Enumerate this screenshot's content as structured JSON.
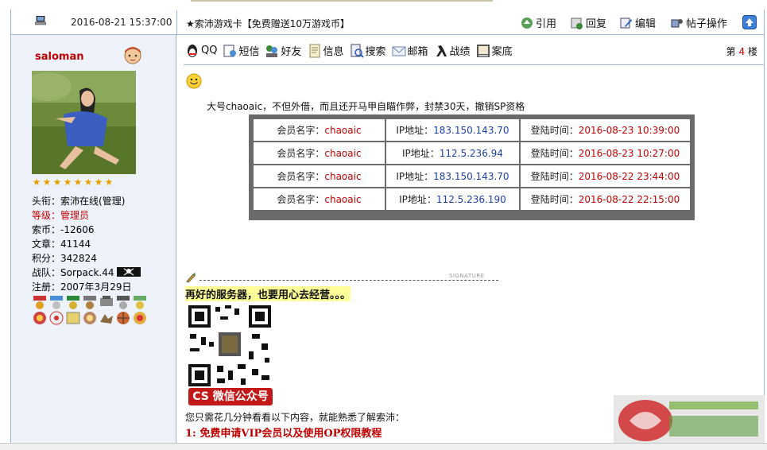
{
  "post": {
    "date": "2016-08-21 15:37:00",
    "title": "★索沛游戏卡【免费赠送10万游戏币】",
    "buttons": [
      {
        "label": "引用",
        "icon": "quote-icon"
      },
      {
        "label": "回复",
        "icon": "reply-icon"
      },
      {
        "label": "编辑",
        "icon": "edit-icon"
      },
      {
        "label": "帖子操作",
        "icon": "post-actions-icon"
      }
    ]
  },
  "user": {
    "name": "saloman",
    "stars": 8,
    "title_label": "头衔：",
    "title_value": "索沛在线(管理)",
    "level_label": "等级：",
    "level_value": "管理员",
    "coins_label": "索币：",
    "coins_value": "-12606",
    "posts_label": "文章：",
    "posts_value": "41144",
    "points_label": "积分：",
    "points_value": "342824",
    "team_label": "战队：",
    "team_value": "Sorpack.44",
    "reg_label": "注册：",
    "reg_value": "2007年3月29日"
  },
  "actions": [
    {
      "label": "QQ",
      "icon": "qq-icon"
    },
    {
      "label": "短信",
      "icon": "message-icon"
    },
    {
      "label": "好友",
      "icon": "friends-icon"
    },
    {
      "label": "信息",
      "icon": "info-icon"
    },
    {
      "label": "搜索",
      "icon": "search-icon"
    },
    {
      "label": "邮箱",
      "icon": "mail-icon"
    },
    {
      "label": "战绩",
      "icon": "record-icon"
    },
    {
      "label": "案底",
      "icon": "file-icon"
    }
  ],
  "floor": {
    "prefix": "第",
    "num": "4",
    "suffix": "楼"
  },
  "message": "大号chaoaic，不但外借，而且还开马甲自瞄作弊，封禁30天，撤销SP资格",
  "log": {
    "member_label": "会员名字：",
    "ip_label": "IP地址：",
    "time_label": "登陆时间：",
    "rows": [
      {
        "member": "chaoaic",
        "ip": "183.150.143.70",
        "time": "2016-08-23 10:39:00"
      },
      {
        "member": "chaoaic",
        "ip": "112.5.236.94",
        "time": "2016-08-23 10:27:00"
      },
      {
        "member": "chaoaic",
        "ip": "183.150.143.70",
        "time": "2016-08-22 23:44:00"
      },
      {
        "member": "chaoaic",
        "ip": "112.5.236.190",
        "time": "2016-08-22 22:15:00"
      }
    ]
  },
  "signature": {
    "tag": "SIGNATURE",
    "slogan": "再好的服务器，也要用心去经营。。。",
    "qr_caption": "CS 微信公众号",
    "intro": "您只需花几分钟看看以下内容，就能熟悉了解索沛：",
    "item1": "1: 免费申请VIP会员以及使用OP权限教程"
  },
  "colors": {
    "accent_red": "#c00000",
    "ip_blue": "#1b3fa8",
    "border": "#9cb3d6",
    "sidebar_bg": "#eef3fb"
  }
}
